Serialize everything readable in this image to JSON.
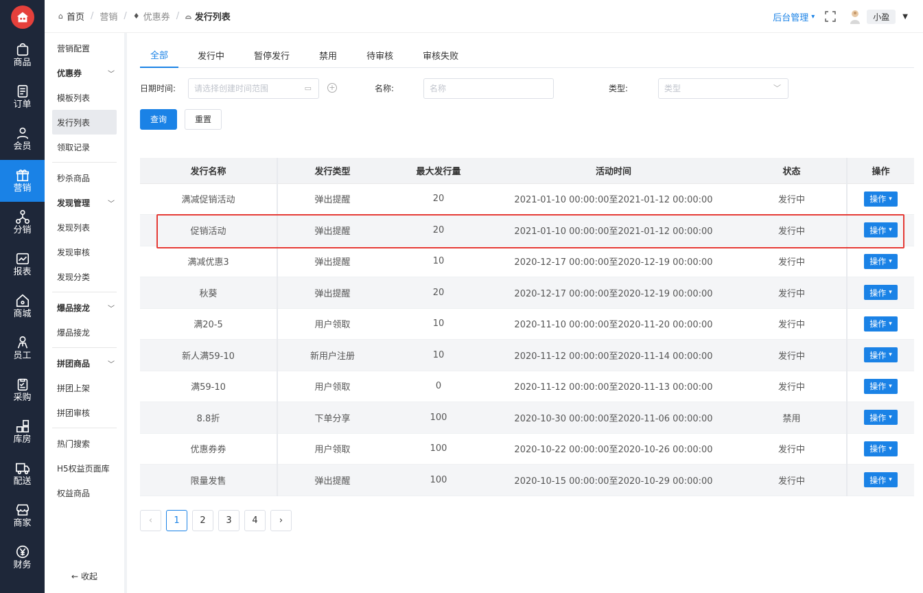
{
  "nav": {
    "items": [
      {
        "label": "商品",
        "icon": "shopping-bag-icon"
      },
      {
        "label": "订单",
        "icon": "document-icon"
      },
      {
        "label": "会员",
        "icon": "user-icon"
      },
      {
        "label": "营销",
        "icon": "gift-icon",
        "active": true
      },
      {
        "label": "分销",
        "icon": "network-icon"
      },
      {
        "label": "报表",
        "icon": "chart-icon"
      },
      {
        "label": "商城",
        "icon": "home-icon"
      },
      {
        "label": "员工",
        "icon": "staff-icon"
      },
      {
        "label": "采购",
        "icon": "clipboard-icon"
      },
      {
        "label": "库房",
        "icon": "grid-icon"
      },
      {
        "label": "配送",
        "icon": "truck-icon"
      },
      {
        "label": "商家",
        "icon": "store-icon"
      },
      {
        "label": "财务",
        "icon": "yen-icon"
      }
    ]
  },
  "header": {
    "breadcrumb": [
      "首页",
      "营销",
      "优惠券",
      "发行列表"
    ],
    "admin_label": "后台管理",
    "user_name": "小盈"
  },
  "subnav": {
    "marketing_config": "营销配置",
    "group_coupon": "优惠券",
    "template_list": "模板列表",
    "issue_list": "发行列表",
    "claim_records": "领取记录",
    "flash_sale": "秒杀商品",
    "group_discover": "发现管理",
    "discover_list": "发现列表",
    "discover_review": "发现审核",
    "discover_category": "发现分类",
    "group_hot_relay": "爆品接龙",
    "hot_relay": "爆品接龙",
    "group_groupbuy": "拼团商品",
    "groupbuy_listing": "拼团上架",
    "groupbuy_review": "拼团审核",
    "hot_search": "热门搜索",
    "h5_pages": "H5权益页面库",
    "benefit_goods": "权益商品",
    "collapse": "收起"
  },
  "tabs": [
    "全部",
    "发行中",
    "暂停发行",
    "禁用",
    "待审核",
    "审核失败"
  ],
  "filters": {
    "date_label": "日期时间:",
    "date_placeholder": "请选择创建时间范围",
    "name_label": "名称:",
    "name_placeholder": "名称",
    "type_label": "类型:",
    "type_placeholder": "类型"
  },
  "buttons": {
    "query": "查询",
    "reset": "重置"
  },
  "table": {
    "headers": [
      "发行名称",
      "发行类型",
      "最大发行量",
      "活动时间",
      "状态",
      "操作"
    ],
    "op_label": "操作",
    "rows": [
      [
        "满减促销活动",
        "弹出提醒",
        "20",
        "2021-01-10 00:00:00至2021-01-12 00:00:00",
        "发行中"
      ],
      [
        "促销活动",
        "弹出提醒",
        "20",
        "2021-01-10 00:00:00至2021-01-12 00:00:00",
        "发行中"
      ],
      [
        "满减优惠3",
        "弹出提醒",
        "10",
        "2020-12-17 00:00:00至2020-12-19 00:00:00",
        "发行中"
      ],
      [
        "秋葵",
        "弹出提醒",
        "20",
        "2020-12-17 00:00:00至2020-12-19 00:00:00",
        "发行中"
      ],
      [
        "满20-5",
        "用户领取",
        "10",
        "2020-11-10 00:00:00至2020-11-20 00:00:00",
        "发行中"
      ],
      [
        "新人满59-10",
        "新用户注册",
        "10",
        "2020-11-12 00:00:00至2020-11-14 00:00:00",
        "发行中"
      ],
      [
        "满59-10",
        "用户领取",
        "0",
        "2020-11-12 00:00:00至2020-11-13 00:00:00",
        "发行中"
      ],
      [
        "8.8折",
        "下单分享",
        "100",
        "2020-10-30 00:00:00至2020-11-06 00:00:00",
        "禁用"
      ],
      [
        "优惠券券",
        "用户领取",
        "100",
        "2020-10-22 00:00:00至2020-10-26 00:00:00",
        "发行中"
      ],
      [
        "限量发售",
        "弹出提醒",
        "100",
        "2020-10-15 00:00:00至2020-10-29 00:00:00",
        "发行中"
      ]
    ]
  },
  "pagination": {
    "pages": [
      "1",
      "2",
      "3",
      "4"
    ],
    "current": "1",
    "prev": "‹",
    "next": "›"
  },
  "colors": {
    "accent": "#1a82e6",
    "nav_bg": "#1e2739",
    "highlight": "#e53a35"
  }
}
